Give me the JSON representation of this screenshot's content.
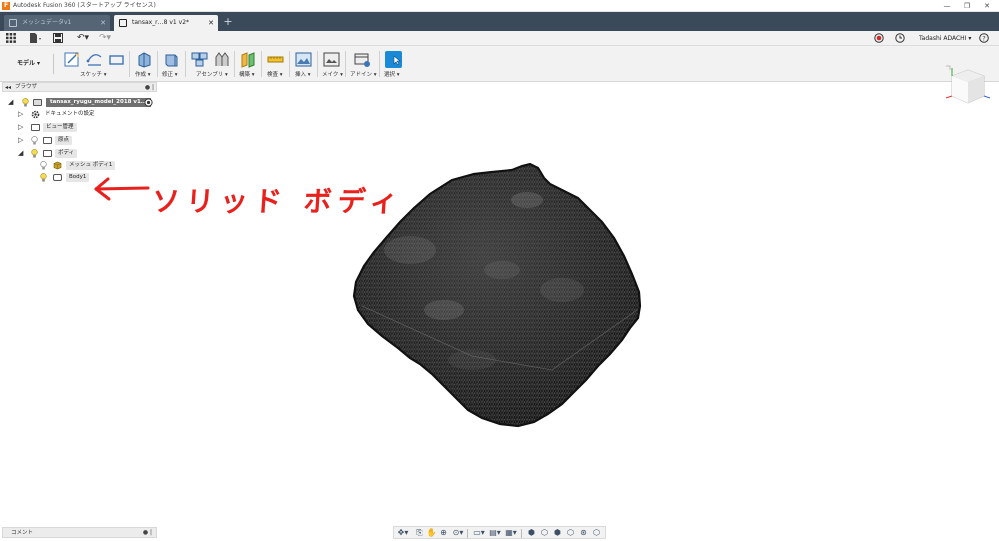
{
  "window": {
    "title": "Autodesk Fusion 360 (スタートアップ ライセンス)",
    "logo_letter": "F",
    "controls": [
      "—",
      "❐",
      "✕"
    ]
  },
  "tabs": [
    {
      "label": "メッシュデータv1",
      "active": false
    },
    {
      "label": "tansax_r…8 v1 v2*",
      "active": true
    }
  ],
  "tab_add": "+",
  "quick_access": {
    "user": "Tadashi ADACHI ▾",
    "help": "?"
  },
  "ribbon": {
    "mode": "モデル ▾",
    "groups": [
      {
        "label": "スケッチ ▾"
      },
      {
        "label": "作成 ▾"
      },
      {
        "label": "修正 ▾"
      },
      {
        "label": "アセンブリ ▾"
      },
      {
        "label": "構築 ▾"
      },
      {
        "label": "検査 ▾"
      },
      {
        "label": "挿入 ▾"
      },
      {
        "label": "メイク ▾"
      },
      {
        "label": "アドイン ▾"
      },
      {
        "label": "選択 ▾"
      }
    ]
  },
  "browser": {
    "title": "ブラウザ",
    "collapse": "◂◂",
    "controls": "● |",
    "root": "tansax_ryugu_model_2018 v1...",
    "items": [
      {
        "label": "ドキュメントの設定"
      },
      {
        "label": "ビュー管理"
      },
      {
        "label": "原点"
      },
      {
        "label": "ボディ"
      },
      {
        "label": "メッシュ ボディ1"
      },
      {
        "label": "Body1"
      }
    ]
  },
  "annotation": {
    "arrow": "←",
    "text": "ソリッド ボディ",
    "color": "#e8211c"
  },
  "comments": {
    "label": "コメント",
    "controls": "● |"
  },
  "colors": {
    "tabbar": "#3b4a5b",
    "select_accent": "#1b8ad6",
    "mesh": "#1a1a1a"
  }
}
